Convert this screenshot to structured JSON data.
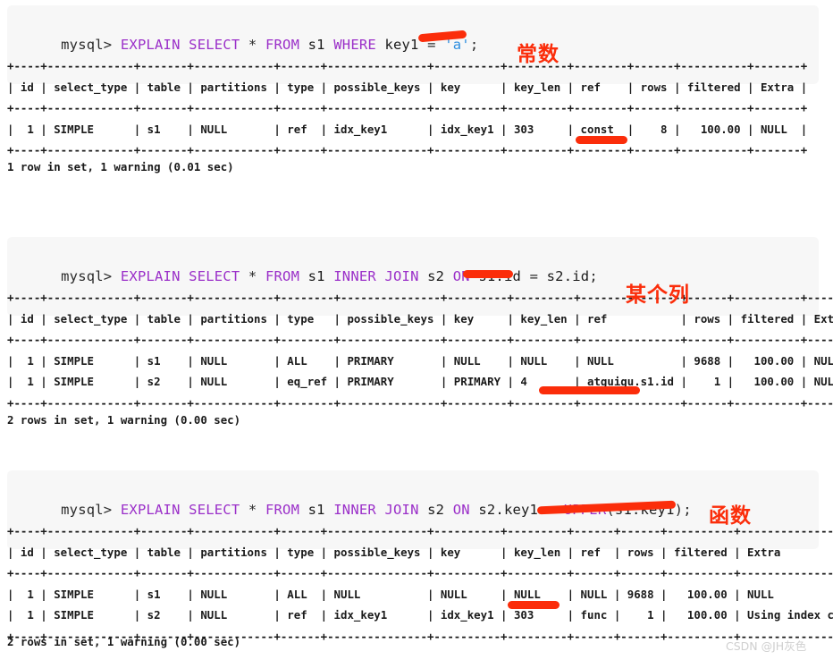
{
  "meta": {
    "watermark": "CSDN @JH灰色",
    "accent_red": "#fb2d0a",
    "keyword_purple": "#9b30c9",
    "string_blue": "#2e8fe0",
    "code_bg": "#f7f7f7"
  },
  "blocks": [
    {
      "id": "block-1",
      "query": {
        "prompt": "mysql> ",
        "tokens": [
          {
            "t": "EXPLAIN",
            "k": "keyword"
          },
          {
            "t": " ",
            "k": "punct"
          },
          {
            "t": "SELECT",
            "k": "keyword"
          },
          {
            "t": " * ",
            "k": "punct"
          },
          {
            "t": "FROM",
            "k": "keyword"
          },
          {
            "t": " s1 ",
            "k": "ident"
          },
          {
            "t": "WHERE",
            "k": "keyword"
          },
          {
            "t": " key1 ",
            "k": "ident"
          },
          {
            "t": "= ",
            "k": "punct"
          },
          {
            "t": "'a'",
            "k": "string"
          },
          {
            "t": ";",
            "k": "punct"
          }
        ],
        "plain": "mysql> EXPLAIN SELECT * FROM s1 WHERE key1 = 'a';"
      },
      "annotation": "常数",
      "status": "1 row in set, 1 warning (0.01 sec)",
      "table": {
        "columns": [
          "id",
          "select_type",
          "table",
          "partitions",
          "type",
          "possible_keys",
          "key",
          "key_len",
          "ref",
          "rows",
          "filtered",
          "Extra"
        ],
        "widths": [
          4,
          13,
          7,
          12,
          6,
          15,
          10,
          9,
          8,
          6,
          10,
          7
        ],
        "aligns": [
          "right",
          "left",
          "left",
          "left",
          "left",
          "left",
          "left",
          "left",
          "left",
          "right",
          "right",
          "left"
        ],
        "rows": [
          [
            "1",
            "SIMPLE",
            "s1",
            "NULL",
            "ref",
            "idx_key1",
            "idx_key1",
            "303",
            "const",
            "8",
            "100.00",
            "NULL"
          ]
        ]
      }
    },
    {
      "id": "block-2",
      "query": {
        "prompt": "mysql> ",
        "tokens": [
          {
            "t": "EXPLAIN",
            "k": "keyword"
          },
          {
            "t": " ",
            "k": "punct"
          },
          {
            "t": "SELECT",
            "k": "keyword"
          },
          {
            "t": " * ",
            "k": "punct"
          },
          {
            "t": "FROM",
            "k": "keyword"
          },
          {
            "t": " s1 ",
            "k": "ident"
          },
          {
            "t": "INNER",
            "k": "keyword"
          },
          {
            "t": " ",
            "k": "punct"
          },
          {
            "t": "JOIN",
            "k": "keyword"
          },
          {
            "t": " s2 ",
            "k": "ident"
          },
          {
            "t": "ON",
            "k": "keyword"
          },
          {
            "t": " s1.id ",
            "k": "ident"
          },
          {
            "t": "= ",
            "k": "punct"
          },
          {
            "t": "s2.id",
            "k": "ident"
          },
          {
            "t": ";",
            "k": "punct"
          }
        ],
        "plain": "mysql> EXPLAIN SELECT * FROM s1 INNER JOIN s2 ON s1.id = s2.id;"
      },
      "annotation": "某个列",
      "status": "2 rows in set, 1 warning (0.00 sec)",
      "table": {
        "columns": [
          "id",
          "select_type",
          "table",
          "partitions",
          "type",
          "possible_keys",
          "key",
          "key_len",
          "ref",
          "rows",
          "filtered",
          "Extra"
        ],
        "widths": [
          4,
          13,
          7,
          12,
          8,
          15,
          9,
          9,
          15,
          6,
          10,
          7
        ],
        "aligns": [
          "right",
          "left",
          "left",
          "left",
          "left",
          "left",
          "left",
          "left",
          "left",
          "right",
          "right",
          "left"
        ],
        "rows": [
          [
            "1",
            "SIMPLE",
            "s1",
            "NULL",
            "ALL",
            "PRIMARY",
            "NULL",
            "NULL",
            "NULL",
            "9688",
            "100.00",
            "NULL"
          ],
          [
            "1",
            "SIMPLE",
            "s2",
            "NULL",
            "eq_ref",
            "PRIMARY",
            "PRIMARY",
            "4",
            "atguigu.s1.id",
            "1",
            "100.00",
            "NULL"
          ]
        ]
      }
    },
    {
      "id": "block-3",
      "query": {
        "prompt": "mysql> ",
        "tokens": [
          {
            "t": "EXPLAIN",
            "k": "keyword"
          },
          {
            "t": " ",
            "k": "punct"
          },
          {
            "t": "SELECT",
            "k": "keyword"
          },
          {
            "t": " * ",
            "k": "punct"
          },
          {
            "t": "FROM",
            "k": "keyword"
          },
          {
            "t": " s1 ",
            "k": "ident"
          },
          {
            "t": "INNER",
            "k": "keyword"
          },
          {
            "t": " ",
            "k": "punct"
          },
          {
            "t": "JOIN",
            "k": "keyword"
          },
          {
            "t": " s2 ",
            "k": "ident"
          },
          {
            "t": "ON",
            "k": "keyword"
          },
          {
            "t": " s2.key1 ",
            "k": "ident"
          },
          {
            "t": "= ",
            "k": "punct"
          },
          {
            "t": "UPPER",
            "k": "func"
          },
          {
            "t": "(",
            "k": "punct"
          },
          {
            "t": "s1.key1",
            "k": "ident"
          },
          {
            "t": ")",
            "k": "punct"
          },
          {
            "t": ";",
            "k": "punct"
          }
        ],
        "plain": "mysql> EXPLAIN SELECT * FROM s1 INNER JOIN s2 ON s2.key1 = UPPER(s1.key1);"
      },
      "annotation": "函数",
      "status": "2 rows in set, 1 warning (0.00 sec)",
      "table": {
        "columns": [
          "id",
          "select_type",
          "table",
          "partitions",
          "type",
          "possible_keys",
          "key",
          "key_len",
          "ref",
          "rows",
          "filtered",
          "Extra"
        ],
        "widths": [
          4,
          13,
          7,
          12,
          6,
          15,
          10,
          9,
          6,
          6,
          10,
          22
        ],
        "aligns": [
          "right",
          "left",
          "left",
          "left",
          "left",
          "left",
          "left",
          "left",
          "left",
          "right",
          "right",
          "left"
        ],
        "rows": [
          [
            "1",
            "SIMPLE",
            "s1",
            "NULL",
            "ALL",
            "NULL",
            "NULL",
            "NULL",
            "NULL",
            "9688",
            "100.00",
            "NULL"
          ],
          [
            "1",
            "SIMPLE",
            "s2",
            "NULL",
            "ref",
            "idx_key1",
            "idx_key1",
            "303",
            "func",
            "1",
            "100.00",
            "Using index condition"
          ]
        ]
      }
    }
  ]
}
